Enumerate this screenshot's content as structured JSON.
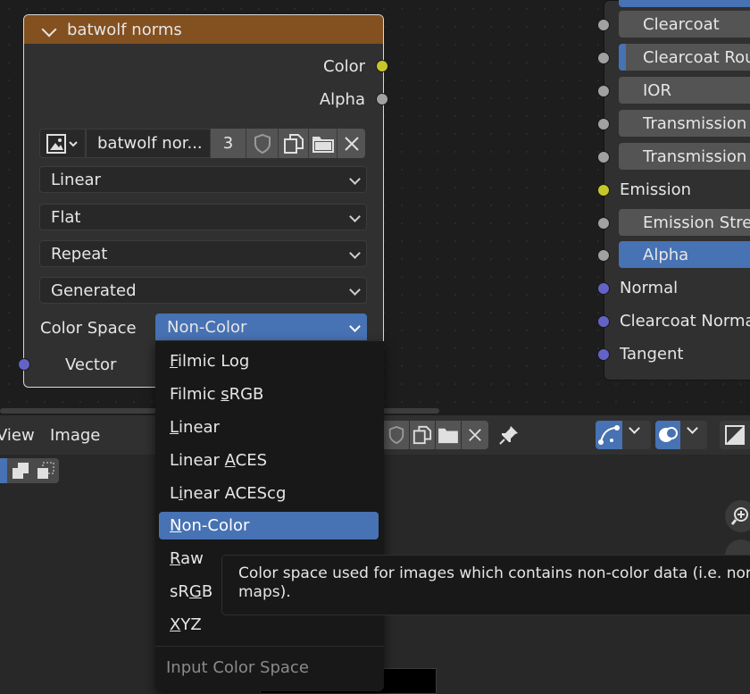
{
  "image_node": {
    "title": "batwolf norms",
    "outputs": {
      "color": "Color",
      "alpha": "Alpha"
    },
    "image_name": "batwolf nor...",
    "user_count": "3",
    "interpolation": "Linear",
    "projection": "Flat",
    "extension": "Repeat",
    "source": "Generated",
    "color_space_label": "Color Space",
    "color_space_value": "Non-Color",
    "input_vector": "Vector"
  },
  "principled_node": {
    "inputs": [
      {
        "label": "Clearcoat",
        "type": "field"
      },
      {
        "label": "Clearcoat Roughness",
        "type": "field-bar"
      },
      {
        "label": "IOR",
        "type": "field"
      },
      {
        "label": "Transmission",
        "type": "field"
      },
      {
        "label": "Transmission Roughness",
        "type": "field"
      },
      {
        "label": "Emission",
        "type": "label"
      },
      {
        "label": "Emission Strength",
        "type": "field"
      },
      {
        "label": "Alpha",
        "type": "field-selected"
      },
      {
        "label": "Normal",
        "type": "label"
      },
      {
        "label": "Clearcoat Normal",
        "type": "label"
      },
      {
        "label": "Tangent",
        "type": "label"
      }
    ]
  },
  "image_editor": {
    "menu": {
      "view": "View",
      "image": "Image"
    }
  },
  "color_space_menu": {
    "items": [
      {
        "label": "Filmic Log",
        "mnemonic": "F",
        "rest": "ilmic Log"
      },
      {
        "label": "Filmic sRGB",
        "pre": "Filmic ",
        "mnemonic": "s",
        "rest": "RGB"
      },
      {
        "label": "Linear",
        "mnemonic": "L",
        "rest": "inear"
      },
      {
        "label": "Linear ACES",
        "pre": "Linear ",
        "mnemonic": "A",
        "rest": "CES"
      },
      {
        "label": "Linear ACEScg",
        "pre": "L",
        "mnemonic": "i",
        "rest": "near ACEScg"
      },
      {
        "label": "Non-Color",
        "mnemonic": "N",
        "rest": "on-Color",
        "selected": true
      },
      {
        "label": "Raw",
        "mnemonic": "R",
        "rest": "aw"
      },
      {
        "label": "sRGB",
        "pre": "sR",
        "mnemonic": "G",
        "rest": "B"
      },
      {
        "label": "XYZ",
        "mnemonic": "X",
        "rest": "YZ"
      }
    ],
    "footer": "Input Color Space"
  },
  "tooltip": {
    "line1": "Color space used for images which contains non-color data (i.e. normal",
    "line2": "maps)."
  },
  "colors": {
    "node_header": "#83501f",
    "selected": "#4772b3",
    "socket_yellow": "#c7c729",
    "socket_grey": "#a1a1a1",
    "socket_blue": "#6363c7"
  }
}
